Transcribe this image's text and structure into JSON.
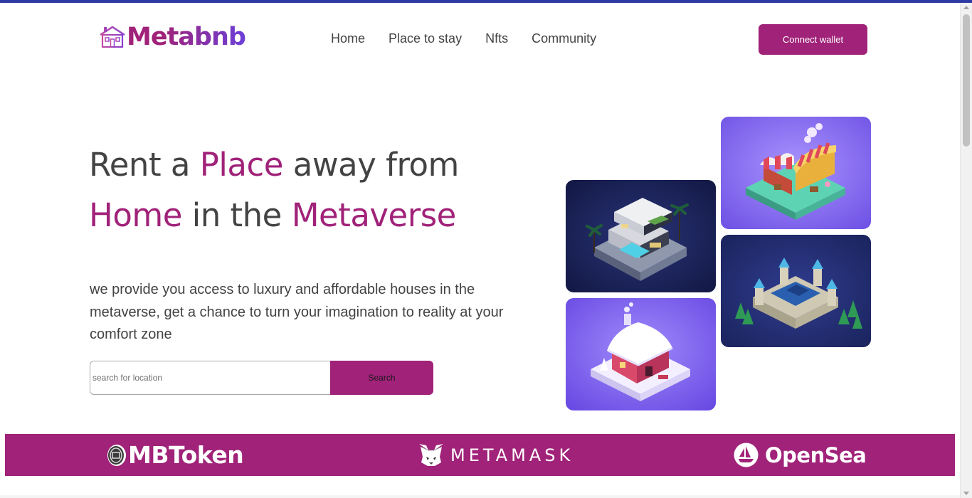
{
  "brand": {
    "logo_text": "Metabnb",
    "logo_icon": "house-icon",
    "primary_color": "#A02279",
    "gradient_end": "#6B3FD8"
  },
  "nav": {
    "items": [
      {
        "label": "Home"
      },
      {
        "label": "Place to stay"
      },
      {
        "label": "Nfts"
      },
      {
        "label": "Community"
      }
    ]
  },
  "header": {
    "connect_label": "Connect wallet"
  },
  "hero": {
    "title_part1": "Rent a ",
    "title_accent1": "Place",
    "title_part2": " away from ",
    "title_accent2": "Home",
    "title_part3": " in the ",
    "title_accent3": "Metaverse",
    "description": "we provide you access to luxury and affordable houses in the metaverse, get a chance to turn your imagination to reality at your comfort zone"
  },
  "search": {
    "placeholder": "search for location",
    "value": "",
    "button_label": "Search"
  },
  "gallery": [
    {
      "name": "villa-image",
      "background": "#1b2257"
    },
    {
      "name": "market-image",
      "background": "#8b6ef2"
    },
    {
      "name": "castle-image",
      "background": "#1f2a6d"
    },
    {
      "name": "cottage-image",
      "background": "#7d62ef"
    }
  ],
  "partners": {
    "mbtoken": "MBToken",
    "metamask": "METAMASK",
    "opensea": "OpenSea"
  }
}
